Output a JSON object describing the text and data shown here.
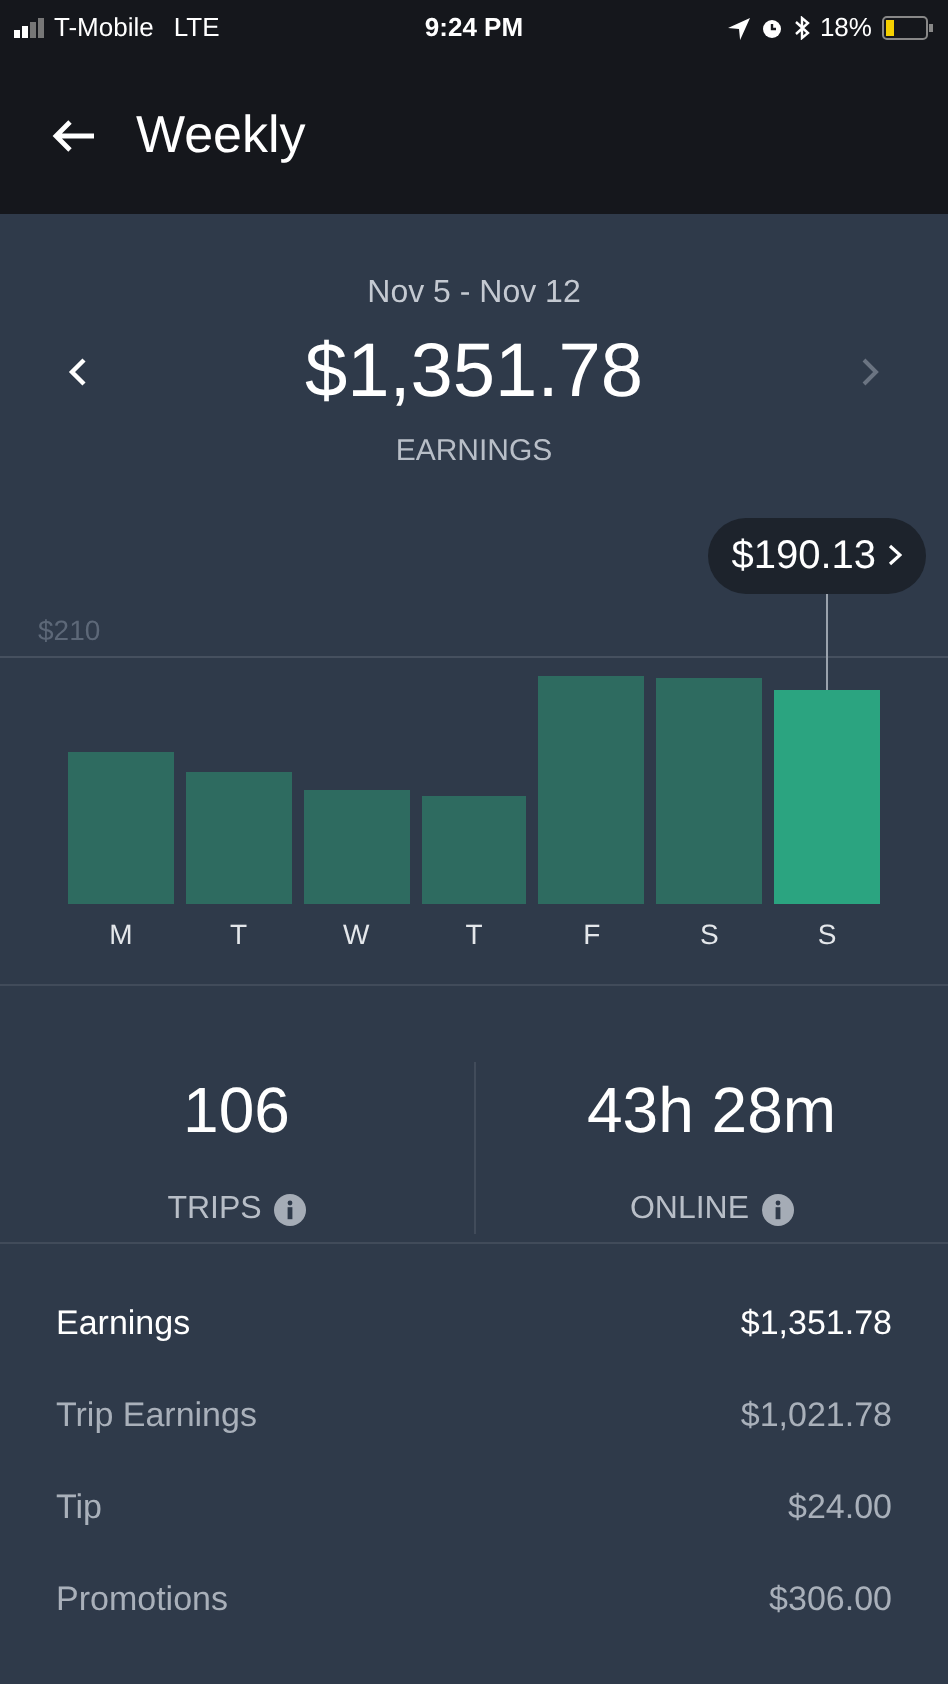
{
  "status_bar": {
    "carrier": "T-Mobile",
    "network": "LTE",
    "time": "9:24 PM",
    "battery": "18%"
  },
  "header": {
    "title": "Weekly"
  },
  "summary": {
    "date_range": "Nov 5 - Nov 12",
    "amount": "$1,351.78",
    "label": "EARNINGS"
  },
  "chart": {
    "axis_label": "$210",
    "tooltip": "$190.13",
    "days": [
      {
        "label": "M",
        "selected": false
      },
      {
        "label": "T",
        "selected": false
      },
      {
        "label": "W",
        "selected": false
      },
      {
        "label": "T",
        "selected": false
      },
      {
        "label": "F",
        "selected": false
      },
      {
        "label": "S",
        "selected": false
      },
      {
        "label": "S",
        "selected": true
      }
    ]
  },
  "stats": [
    {
      "value": "106",
      "label": "TRIPS"
    },
    {
      "value": "43h 28m",
      "label": "ONLINE"
    }
  ],
  "breakdown": [
    {
      "label": "Earnings",
      "amount": "$1,351.78",
      "kind": "total"
    },
    {
      "label": "Trip Earnings",
      "amount": "$1,021.78",
      "kind": "item"
    },
    {
      "label": "Tip",
      "amount": "$24.00",
      "kind": "item"
    },
    {
      "label": "Promotions",
      "amount": "$306.00",
      "kind": "item"
    }
  ]
}
